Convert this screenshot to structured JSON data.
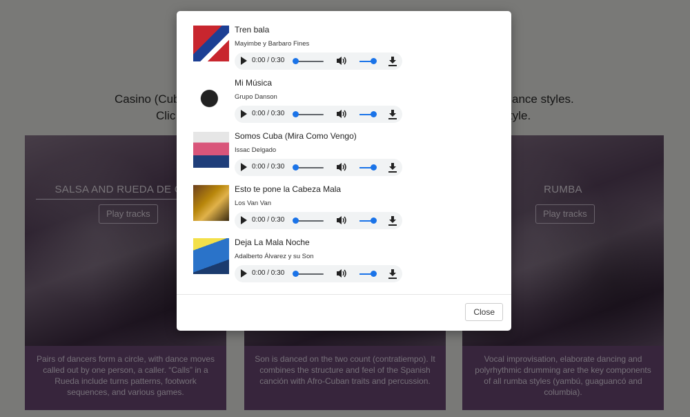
{
  "intro": {
    "line1_left": "Casino (Cub",
    "line1_right": "ance styles.",
    "line2_left": "Clic",
    "line2_right": "tyle."
  },
  "cards": [
    {
      "title": "SALSA AND RUEDA DE CAS",
      "play_label": "Play tracks",
      "description": "Pairs of dancers form a circle, with dance moves called out by one person, a caller. “Calls” in a Rueda include turns patterns, footwork sequences, and various games."
    },
    {
      "title": "",
      "play_label": "",
      "description": "Son is danced on the two count (contratiempo). It combines the structure and feel of the Spanish canción with Afro-Cuban traits and percussion."
    },
    {
      "title": "RUMBA",
      "play_label": "Play tracks",
      "description": "Vocal improvisation, elaborate dancing and polyrhythmic drumming are the key components of all rumba styles (yambú, guaguancó and columbia)."
    }
  ],
  "modal": {
    "tracks": [
      {
        "title": "Tren bala",
        "artist": "Mayimbe y Barbaro Fines",
        "time": "0:00 / 0:30",
        "cover_color": "#c8262e"
      },
      {
        "title": "Mi Música",
        "artist": "Grupo Danson",
        "time": "0:00 / 0:30",
        "cover_color": "#3a3a3a"
      },
      {
        "title": "Somos Cuba (Mira Como Vengo)",
        "artist": "Issac Delgado",
        "time": "0:00 / 0:30",
        "cover_color": "#d9557a"
      },
      {
        "title": "Esto te pone la Cabeza Mala",
        "artist": "Los Van Van",
        "time": "0:00 / 0:30",
        "cover_color": "#b8860b"
      },
      {
        "title": "Deja La Mala Noche",
        "artist": "Adalberto Álvarez y su Son",
        "time": "0:00 / 0:30",
        "cover_color": "#2a73c9"
      }
    ],
    "close_label": "Close"
  },
  "colors": {
    "accent": "#1a73e8",
    "card": "#6f4a78",
    "backdrop": "rgba(0,0,0,0.5)"
  },
  "icons": [
    "play-icon",
    "volume-icon",
    "download-icon"
  ]
}
